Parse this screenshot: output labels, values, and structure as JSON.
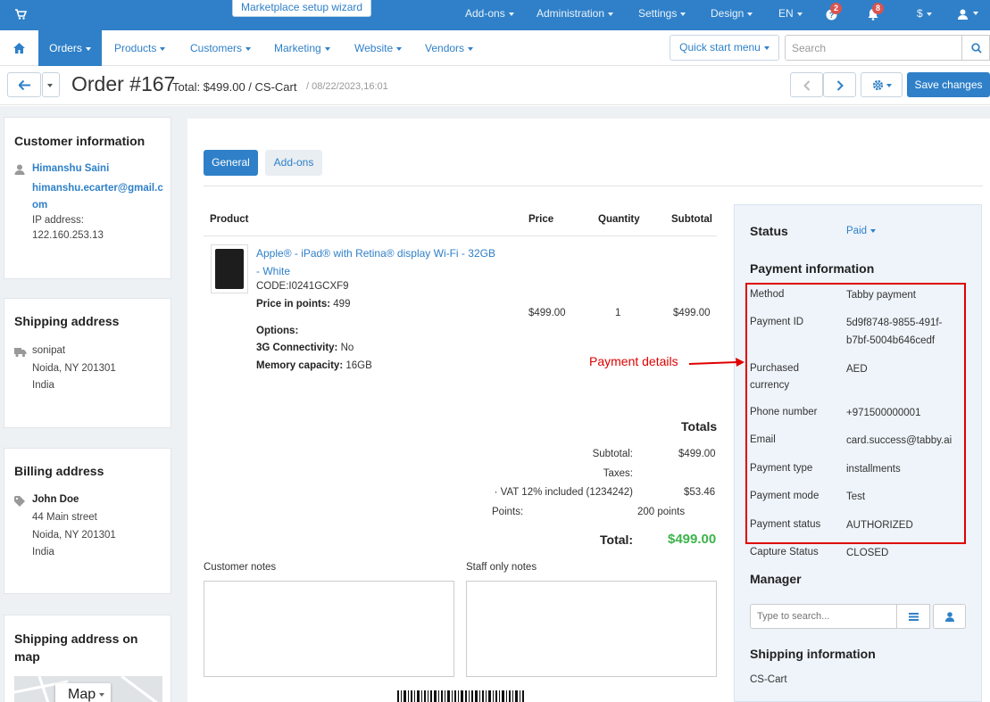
{
  "topbar": {
    "wizard_label": "Marketplace setup wizard",
    "items": [
      {
        "label": "Add-ons"
      },
      {
        "label": "Administration"
      },
      {
        "label": "Settings"
      },
      {
        "label": "Design"
      },
      {
        "label": "EN"
      },
      {
        "label": "$"
      }
    ],
    "help_badge": "2",
    "notif_badge": "8",
    "brand_color": "#2f80c8"
  },
  "nav": {
    "items": [
      {
        "label": "Orders"
      },
      {
        "label": "Products"
      },
      {
        "label": "Customers"
      },
      {
        "label": "Marketing"
      },
      {
        "label": "Website"
      },
      {
        "label": "Vendors"
      }
    ],
    "quick_start": "Quick start menu",
    "search_placeholder": "Search"
  },
  "header": {
    "title": "Order #167",
    "total": "Total: $499.00 / CS-Cart",
    "date": "/ 08/22/2023,16:01",
    "save_label": "Save changes"
  },
  "customer": {
    "heading": "Customer information",
    "name": "Himanshu Saini",
    "email_1": "himanshu.ecarter@gmail.c",
    "email_2": "om",
    "ip_label": "IP address:",
    "ip": "122.160.253.13"
  },
  "shipping": {
    "heading": "Shipping address",
    "line1": "sonipat",
    "line2": "Noida, NY 201301",
    "line3": "India"
  },
  "billing": {
    "heading": "Billing address",
    "name": "John Doe",
    "line1": "44 Main street",
    "line2": "Noida, NY 201301",
    "line3": "India"
  },
  "map": {
    "heading_1": "Shipping address on",
    "heading_2": "map",
    "map_label": "Map"
  },
  "tabs": {
    "general": "General",
    "addons": "Add-ons"
  },
  "table": {
    "headers": {
      "product": "Product",
      "price": "Price",
      "quantity": "Quantity",
      "subtotal": "Subtotal"
    },
    "product_name_1": "Apple® - iPad® with Retina® display Wi-Fi - 32GB",
    "product_name_2": "- White",
    "code": "CODE:I0241GCXF9",
    "points_label": "Price in points:",
    "points_value": "499",
    "options_label": "Options:",
    "conn_label": "3G Connectivity:",
    "conn_value": "No",
    "mem_label": "Memory capacity:",
    "mem_value": "16GB",
    "price": "$499.00",
    "qty": "1",
    "subtotal": "$499.00"
  },
  "totals": {
    "heading": "Totals",
    "subtotal_label": "Subtotal:",
    "subtotal_value": "$499.00",
    "taxes_label": "Taxes:",
    "vat_label": "· VAT 12% included (1234242)",
    "vat_value": "$53.46",
    "points_label": "Points:",
    "points_value": "200 points",
    "total_label": "Total:",
    "total_value": "$499.00"
  },
  "notes": {
    "customer_label": "Customer notes",
    "staff_label": "Staff only notes"
  },
  "status": {
    "label": "Status",
    "value": "Paid"
  },
  "payment": {
    "heading": "Payment information",
    "method_label": "Method",
    "method_value": "Tabby payment",
    "id_label": "Payment ID",
    "id_value_1": "5d9f8748-9855-491f-",
    "id_value_2": "b7bf-5004b646cedf",
    "currency_label_1": "Purchased",
    "currency_label_2": "currency",
    "currency_value": "AED",
    "phone_label": "Phone number",
    "phone_value": "+971500000001",
    "email_label": "Email",
    "email_value": "card.success@tabby.ai",
    "type_label": "Payment type",
    "type_value": "installments",
    "mode_label": "Payment mode",
    "mode_value": "Test",
    "pstatus_label": "Payment status",
    "pstatus_value": "AUTHORIZED",
    "capture_label": "Capture Status",
    "capture_value": "CLOSED"
  },
  "annotation": "Payment details",
  "manager": {
    "heading": "Manager",
    "placeholder": "Type to search..."
  },
  "shipping_info": {
    "heading": "Shipping information",
    "carrier": "CS-Cart"
  }
}
